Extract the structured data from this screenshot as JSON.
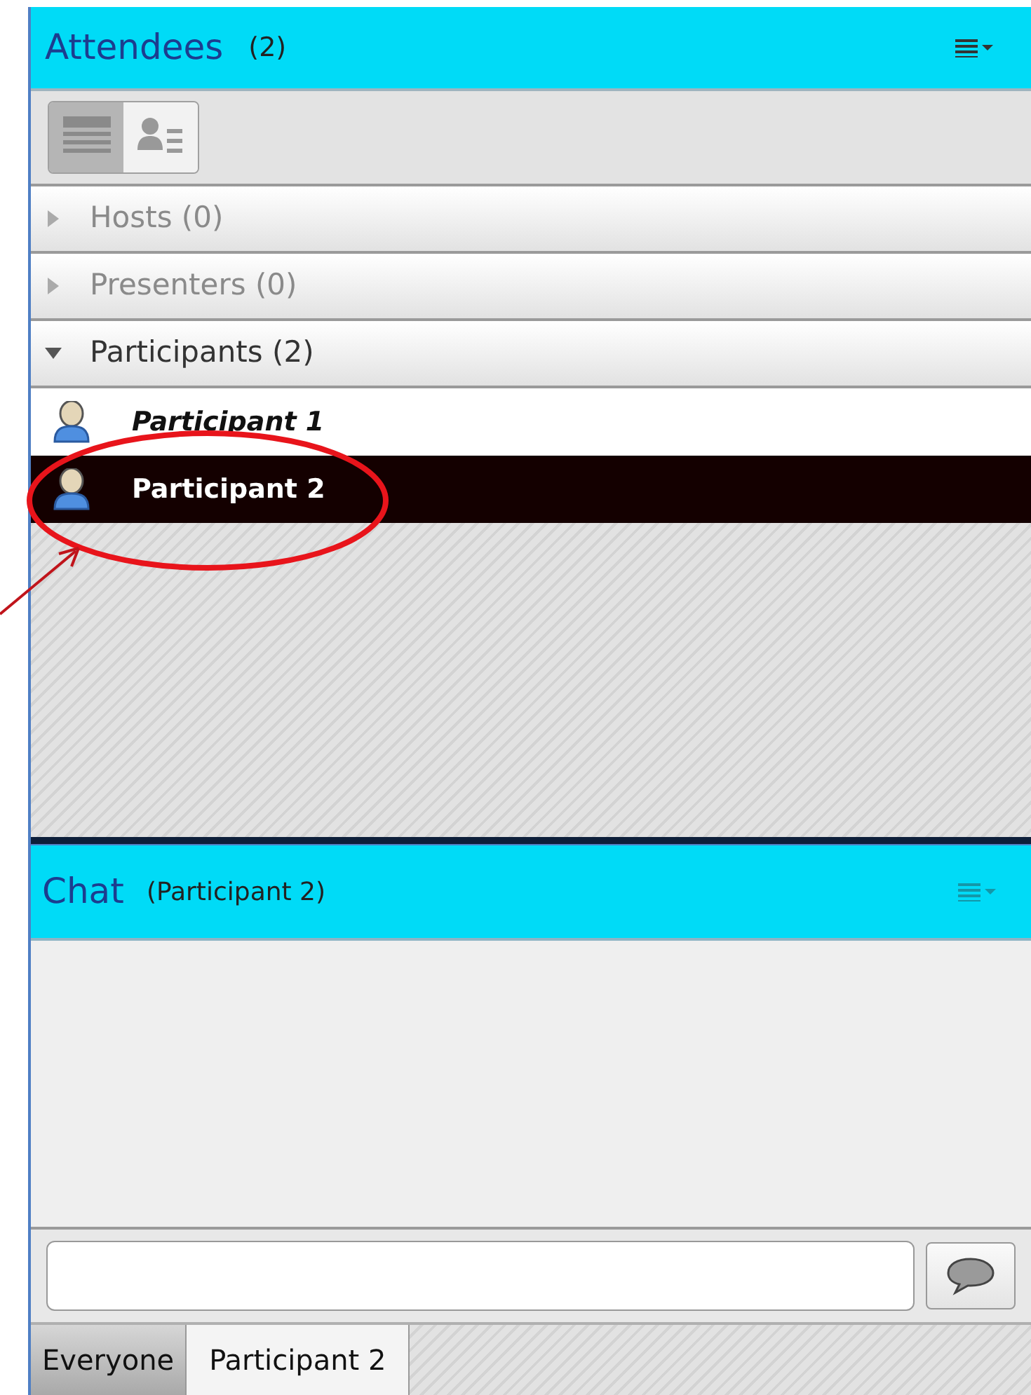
{
  "attendees": {
    "title": "Attendees",
    "count": "(2)",
    "view_toggles": [
      {
        "kind": "list",
        "selected": true
      },
      {
        "kind": "cards",
        "selected": false
      }
    ],
    "sections": [
      {
        "label": "Hosts (0)",
        "expanded": false,
        "disabled": true
      },
      {
        "label": "Presenters (0)",
        "expanded": false,
        "disabled": true
      },
      {
        "label": "Participants (2)",
        "expanded": true,
        "disabled": false,
        "children": [
          {
            "name": "Participant 1",
            "selected": false
          },
          {
            "name": "Participant 2",
            "selected": true
          }
        ]
      }
    ]
  },
  "chat": {
    "title": "Chat",
    "subtitle": "(Participant 2)",
    "tabs": [
      {
        "label": "Everyone",
        "selected": false
      },
      {
        "label": "Participant 2",
        "selected": true
      }
    ]
  }
}
